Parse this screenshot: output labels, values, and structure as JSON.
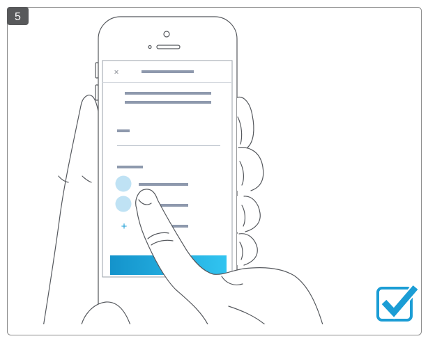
{
  "step": {
    "number": "5"
  },
  "phone_screen": {
    "close_label": "×",
    "add_label": "+"
  },
  "icons": {
    "close": "close-icon",
    "add": "plus-icon",
    "completion": "checkmark-icon"
  },
  "colors": {
    "accent": "#1b9dd5",
    "button_gradient_start": "#1493cb",
    "button_gradient_end": "#31c4f0",
    "avatar": "#bfe2f4",
    "placeholder": "#8e99ad",
    "line_art": "#56595e",
    "badge": "#58595b",
    "frame": "#8a8a8a"
  }
}
